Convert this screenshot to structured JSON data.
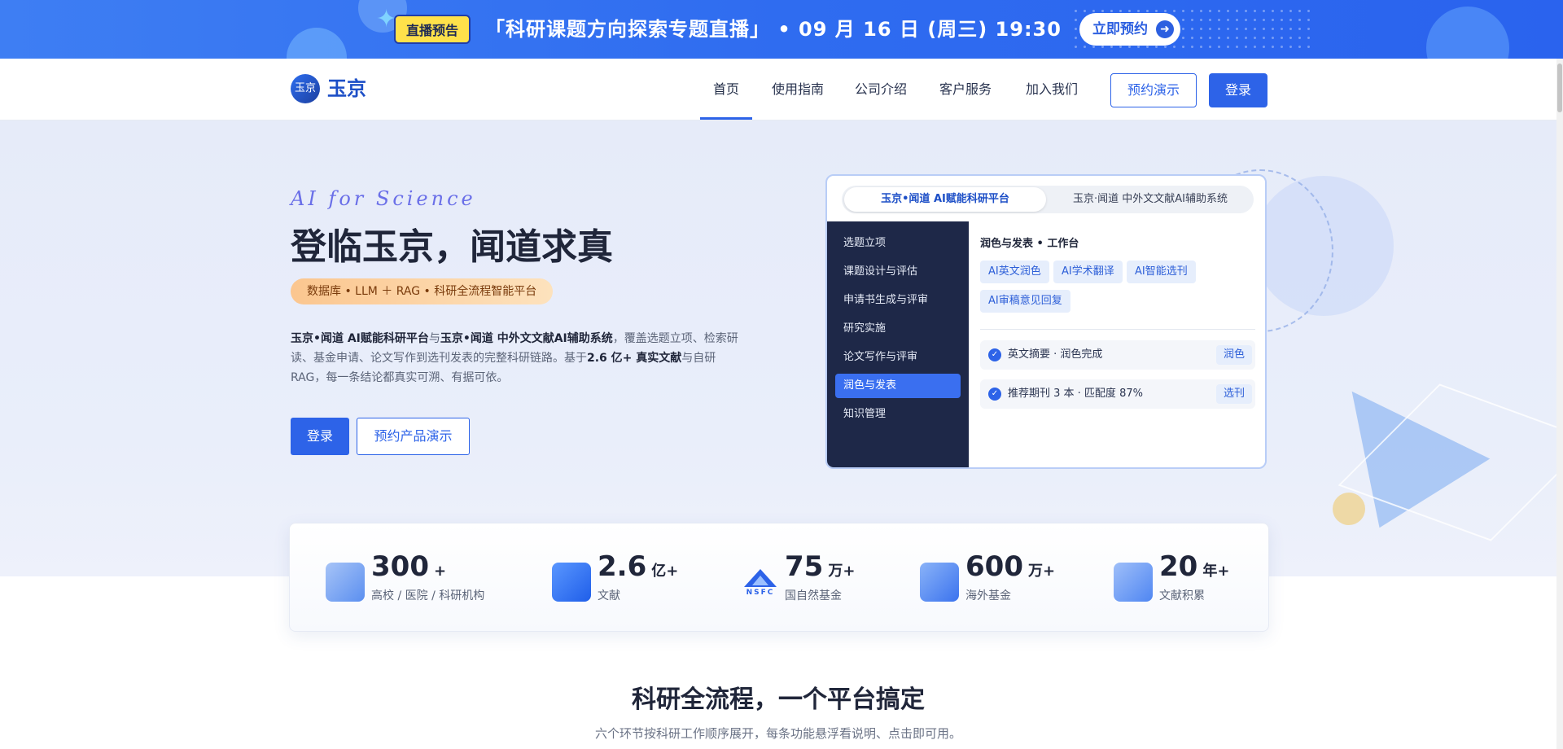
{
  "banner": {
    "tag": "直播预告",
    "title": "「科研课题方向探索专题直播」 • 09 月 16 日 (周三) 19:30",
    "cta": "立即预约"
  },
  "nav": {
    "logo_mark": "玉京",
    "logo": "玉京",
    "items": [
      "首页",
      "使用指南",
      "公司介绍",
      "客户服务",
      "加入我们"
    ],
    "demo": "预约演示",
    "login": "登录"
  },
  "hero": {
    "tagline": "AI for Science",
    "title": "登临玉京，闻道求真",
    "pill": "数据库 • LLM ＋ RAG • 科研全流程智能平台",
    "desc": {
      "p1": "玉京•闻道 AI赋能科研平台",
      "p2": "与",
      "p3": "玉京•闻道 中外文文献AI辅助系统",
      "p4": "，覆盖选题立项、检索研读、基金申请、论文写作到选刊发表的完整科研链路。基于",
      "p5": "2.6 亿+ 真实文献",
      "p6": "与自研 RAG，每一条结论都真实可溯、有据可依。"
    },
    "login": "登录",
    "demo": "预约产品演示"
  },
  "preview": {
    "tabs": [
      "玉京•闻道 AI赋能科研平台",
      "玉京·闻道 中外文文献AI辅助系统"
    ],
    "sidebar": [
      "选题立项",
      "课题设计与评估",
      "申请书生成与评审",
      "研究实施",
      "论文写作与评审",
      "润色与发表",
      "知识管理"
    ],
    "work_title": "润色与发表 • 工作台",
    "chips": [
      "AI英文润色",
      "AI学术翻译",
      "AI智能选刊",
      "AI审稿意见回复"
    ],
    "results": [
      {
        "text": "英文摘要 · 润色完成",
        "action": "润色"
      },
      {
        "text": "推荐期刊 3 本 · 匹配度 87%",
        "action": "选刊"
      }
    ]
  },
  "stats": [
    {
      "num": "300",
      "unit": "+",
      "label": "高校 / 医院 / 科研机构",
      "icon": "building-icon"
    },
    {
      "num": "2.6",
      "unit": "亿+",
      "label": "文献",
      "icon": "document-icon"
    },
    {
      "num": "75",
      "unit": "万+",
      "label": "国自然基金",
      "icon": "nsfc-logo-icon"
    },
    {
      "num": "600",
      "unit": "万+",
      "label": "海外基金",
      "icon": "fund-icon"
    },
    {
      "num": "20",
      "unit": "年+",
      "label": "文献积累",
      "icon": "trend-icon"
    }
  ],
  "nsfc_text": "NSFC",
  "section": {
    "title": "科研全流程，一个平台搞定",
    "subtitle": "六个环节按科研工作顺序展开，每条功能悬浮看说明、点击即可用。"
  },
  "colors": {
    "primary": "#2d63e8",
    "banner": "#2f6cf0",
    "sidebar": "#1e2848",
    "pill": "#fbc68f"
  }
}
